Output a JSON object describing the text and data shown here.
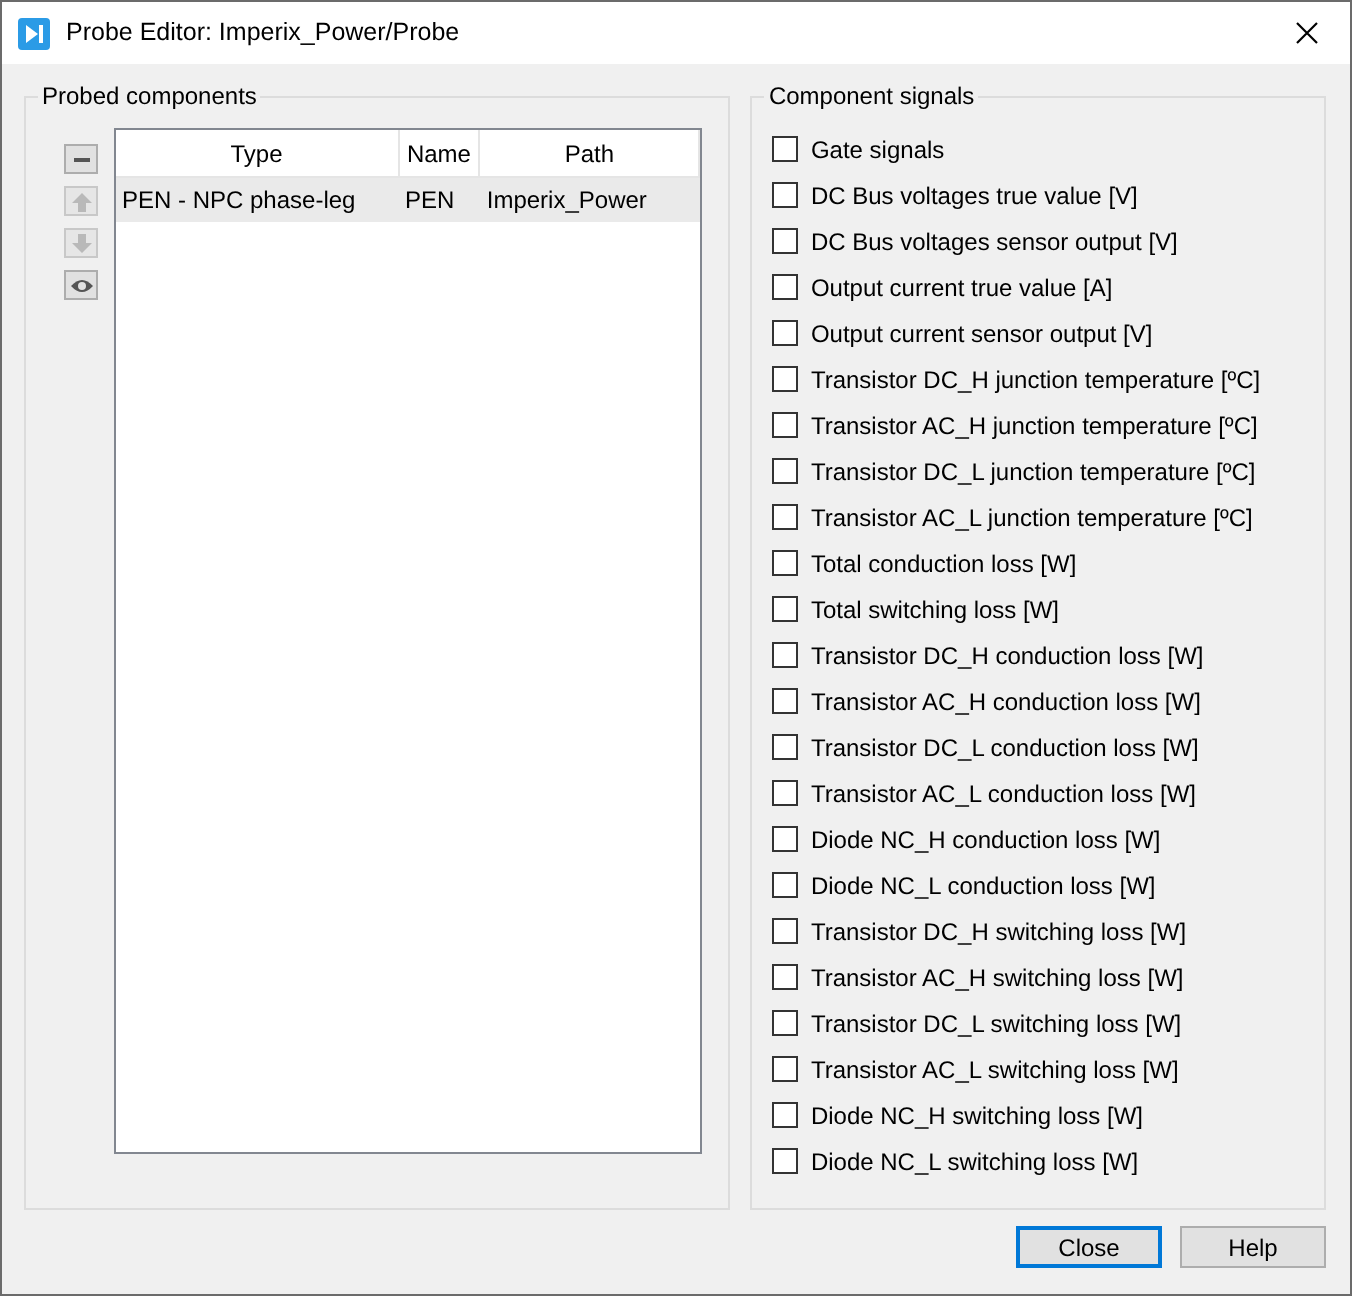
{
  "window": {
    "title": "Probe Editor: Imperix_Power/Probe"
  },
  "probed_components": {
    "title": "Probed components",
    "tools": [
      {
        "kind": "remove",
        "disabled": false
      },
      {
        "kind": "up",
        "disabled": true
      },
      {
        "kind": "down",
        "disabled": true
      },
      {
        "kind": "view",
        "disabled": false
      }
    ],
    "columns": [
      "Type",
      "Name",
      "Path"
    ],
    "rows": [
      {
        "cells": [
          "PEN - NPC phase-leg",
          "PEN",
          "Imperix_Power"
        ],
        "selected": true
      }
    ]
  },
  "component_signals": {
    "title": "Component signals",
    "items": [
      {
        "label": "Gate signals",
        "checked": false
      },
      {
        "label": "DC Bus voltages true value [V]",
        "checked": false
      },
      {
        "label": "DC Bus voltages sensor output [V]",
        "checked": false
      },
      {
        "label": "Output current true value [A]",
        "checked": false
      },
      {
        "label": "Output current sensor output [V]",
        "checked": false
      },
      {
        "label": "Transistor DC_H junction temperature [ºC]",
        "checked": false
      },
      {
        "label": "Transistor AC_H junction temperature [ºC]",
        "checked": false
      },
      {
        "label": "Transistor DC_L junction temperature [ºC]",
        "checked": false
      },
      {
        "label": "Transistor AC_L junction temperature [ºC]",
        "checked": false
      },
      {
        "label": "Total conduction loss [W]",
        "checked": false
      },
      {
        "label": "Total switching loss [W]",
        "checked": false
      },
      {
        "label": "Transistor DC_H conduction loss [W]",
        "checked": false
      },
      {
        "label": "Transistor AC_H conduction loss [W]",
        "checked": false
      },
      {
        "label": "Transistor DC_L conduction loss [W]",
        "checked": false
      },
      {
        "label": "Transistor AC_L conduction loss [W]",
        "checked": false
      },
      {
        "label": "Diode NC_H conduction loss [W]",
        "checked": false
      },
      {
        "label": "Diode NC_L conduction loss [W]",
        "checked": false
      },
      {
        "label": "Transistor DC_H switching loss [W]",
        "checked": false
      },
      {
        "label": "Transistor AC_H switching loss [W]",
        "checked": false
      },
      {
        "label": "Transistor DC_L switching loss [W]",
        "checked": false
      },
      {
        "label": "Transistor AC_L switching loss [W]",
        "checked": false
      },
      {
        "label": "Diode NC_H switching loss [W]",
        "checked": false
      },
      {
        "label": "Diode NC_L switching loss [W]",
        "checked": false
      }
    ]
  },
  "buttons": [
    {
      "label": "Close",
      "default": true
    },
    {
      "label": "Help",
      "default": false
    }
  ]
}
